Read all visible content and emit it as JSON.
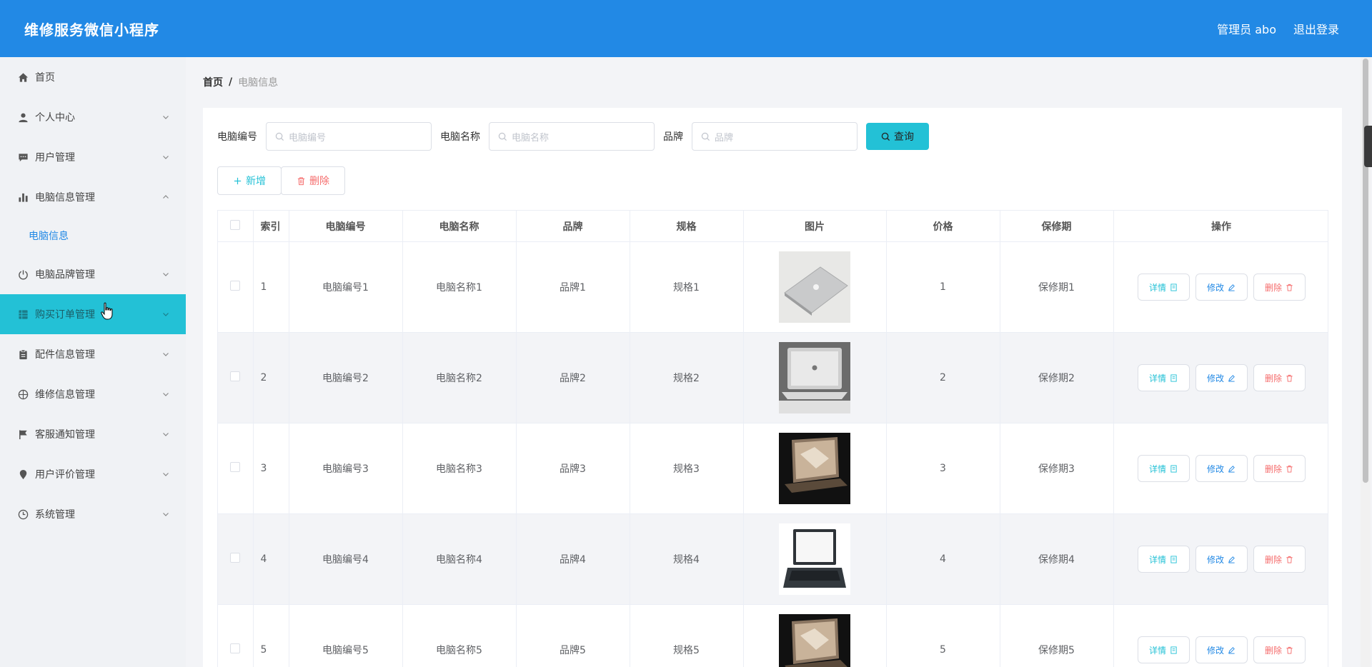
{
  "header": {
    "app_title": "维修服务微信小程序",
    "user_label": "管理员 abo",
    "logout_label": "退出登录"
  },
  "sidebar": {
    "items": [
      {
        "label": "首页",
        "icon": "home-icon",
        "has_chevron": false
      },
      {
        "label": "个人中心",
        "icon": "user-icon",
        "has_chevron": true
      },
      {
        "label": "用户管理",
        "icon": "chat-icon",
        "has_chevron": true
      },
      {
        "label": "电脑信息管理",
        "icon": "bar-chart-icon",
        "has_chevron": true,
        "expanded": true
      },
      {
        "label": "电脑品牌管理",
        "icon": "power-icon",
        "has_chevron": true
      },
      {
        "label": "购买订单管理",
        "icon": "grid-icon",
        "has_chevron": true,
        "highlighted": true
      },
      {
        "label": "配件信息管理",
        "icon": "clipboard-icon",
        "has_chevron": true
      },
      {
        "label": "维修信息管理",
        "icon": "compass-icon",
        "has_chevron": true
      },
      {
        "label": "客服通知管理",
        "icon": "flag-icon",
        "has_chevron": true
      },
      {
        "label": "用户评价管理",
        "icon": "location-icon",
        "has_chevron": true
      },
      {
        "label": "系统管理",
        "icon": "clock-icon",
        "has_chevron": true
      }
    ],
    "submenu": {
      "label": "电脑信息"
    }
  },
  "breadcrumb": {
    "home": "首页",
    "separator": "/",
    "current": "电脑信息"
  },
  "search": {
    "fields": [
      {
        "label": "电脑编号",
        "placeholder": "电脑编号"
      },
      {
        "label": "电脑名称",
        "placeholder": "电脑名称"
      },
      {
        "label": "品牌",
        "placeholder": "品牌"
      }
    ],
    "button_label": "查询"
  },
  "actions": {
    "add_label": "新增",
    "delete_label": "删除"
  },
  "table": {
    "columns": [
      "",
      "索引",
      "电脑编号",
      "电脑名称",
      "品牌",
      "规格",
      "图片",
      "价格",
      "保修期",
      "操作"
    ],
    "operations": {
      "detail": "详情",
      "edit": "修改",
      "delete": "删除"
    },
    "rows": [
      {
        "index": "1",
        "code": "电脑编号1",
        "name": "电脑名称1",
        "brand": "品牌1",
        "spec": "规格1",
        "image": "silver-laptop-closed",
        "price": "1",
        "warranty": "保修期1"
      },
      {
        "index": "2",
        "code": "电脑编号2",
        "name": "电脑名称2",
        "brand": "品牌2",
        "spec": "规格2",
        "image": "silver-laptop-open",
        "price": "2",
        "warranty": "保修期2"
      },
      {
        "index": "3",
        "code": "电脑编号3",
        "name": "电脑名称3",
        "brand": "品牌3",
        "spec": "规格3",
        "image": "gold-laptop-dark",
        "price": "3",
        "warranty": "保修期3"
      },
      {
        "index": "4",
        "code": "电脑编号4",
        "name": "电脑名称4",
        "brand": "品牌4",
        "spec": "规格4",
        "image": "black-laptop-white",
        "price": "4",
        "warranty": "保修期4"
      },
      {
        "index": "5",
        "code": "电脑编号5",
        "name": "电脑名称5",
        "brand": "品牌5",
        "spec": "规格5",
        "image": "gold-laptop-dark",
        "price": "5",
        "warranty": "保修期5"
      }
    ]
  },
  "colors": {
    "primary": "#2289e5",
    "accent": "#23c1d6",
    "danger": "#f56c6c"
  }
}
